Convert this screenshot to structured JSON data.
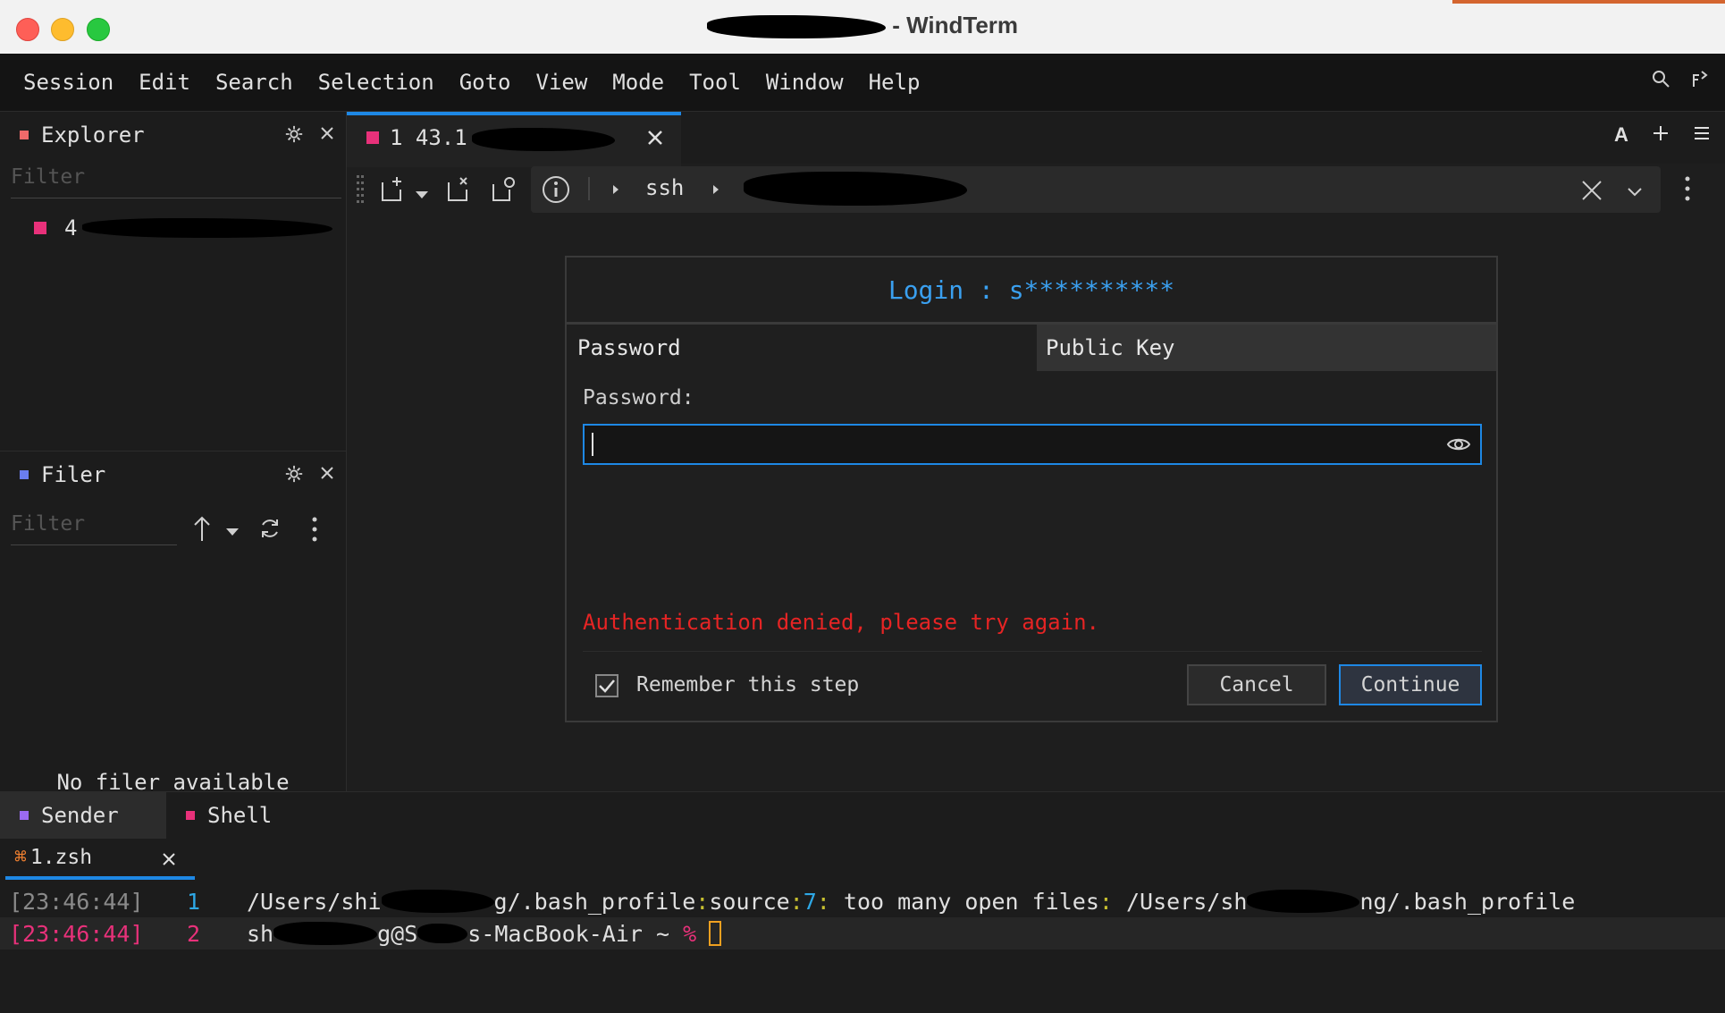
{
  "window": {
    "title_visible": "- WindTerm"
  },
  "menu": {
    "items": [
      "Session",
      "Edit",
      "Search",
      "Selection",
      "Goto",
      "View",
      "Mode",
      "Tool",
      "Window",
      "Help"
    ]
  },
  "explorer": {
    "title": "Explorer",
    "filter_placeholder": "Filter",
    "item_prefix": "4"
  },
  "filer": {
    "title": "Filer",
    "filter_placeholder": "Filter",
    "empty_text": "No filer available"
  },
  "session_tab": {
    "label_prefix": "1 43.1"
  },
  "address": {
    "protocol": "ssh"
  },
  "dialog": {
    "title": "Login : s**********",
    "tabs": [
      "Password",
      "Public Key"
    ],
    "password_label": "Password:",
    "password_value": "",
    "error": "Authentication denied, please try again.",
    "remember_label": "Remember this step",
    "remember_checked": true,
    "cancel_label": "Cancel",
    "continue_label": "Continue"
  },
  "bottom": {
    "tabs": [
      "Sender",
      "Shell"
    ],
    "terminal_tab": "1.zsh",
    "lines": [
      {
        "time": "[23:46:44]",
        "num": "1",
        "text_a": "/Users/shi",
        "text_b": "g/.bash_profile",
        "sep": ":",
        "cmd": "source",
        "lineno": "7",
        "msg": " too many open files",
        "path_a": " /Users/sh",
        "path_b": "ng/.bash_profile"
      },
      {
        "time": "[23:46:44]",
        "num": "2",
        "user_a": "sh",
        "user_b": "g@S",
        "host": "s-MacBook-Air ~ ",
        "prompt": "%"
      }
    ]
  },
  "colors": {
    "accent": "#1e88e5",
    "error": "#e62424",
    "timestamp_current": "#e8317a",
    "line_number": "#2ea8e6",
    "prompt": "#e8317a",
    "cursor": "#f0a020"
  }
}
